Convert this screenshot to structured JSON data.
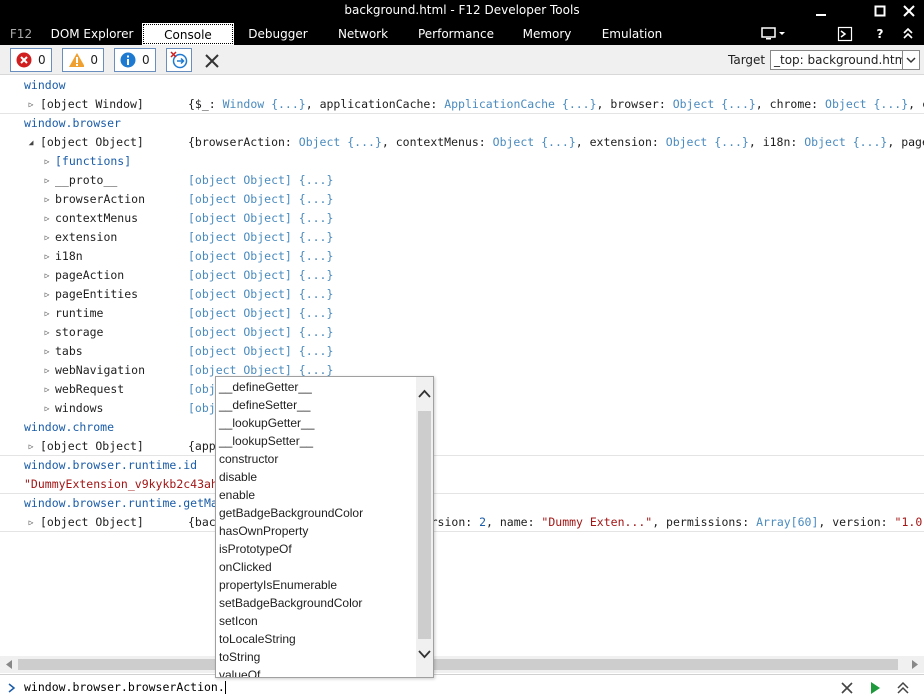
{
  "window": {
    "title": "background.html - F12 Developer Tools"
  },
  "tabs": [
    "F12",
    "DOM Explorer",
    "Console",
    "Debugger",
    "Network",
    "Performance",
    "Memory",
    "Emulation"
  ],
  "toolbar": {
    "errors_count": "0",
    "warnings_count": "0",
    "messages_count": "0",
    "target_label": "Target",
    "target_value": "_top: background.html"
  },
  "console": {
    "lines": [
      {
        "type": "cmd",
        "text": "window"
      },
      {
        "type": "obj",
        "name": "[object Window]",
        "value_html": "{$_: <span class='t'>Window {...}</span>, applicationCache: <span class='t'>ApplicationCache {...}</span>, browser: <span class='t'>Object {...}</span>, chrome: <span class='t'>Object {...}</span>, client"
      },
      {
        "type": "cmd",
        "text": "window.browser"
      },
      {
        "type": "obj",
        "name": "[object Object]",
        "expanded": true,
        "value_html": "{browserAction: <span class='t'>Object {...}</span>, contextMenus: <span class='t'>Object {...}</span>, extension: <span class='t'>Object {...}</span>, i18n: <span class='t'>Object {...}</span>, pageActio"
      }
    ],
    "children": [
      {
        "name": "[functions]",
        "value": ""
      },
      {
        "name": "__proto__",
        "value": "[object Object] {...}"
      },
      {
        "name": "browserAction",
        "value": "[object Object] {...}"
      },
      {
        "name": "contextMenus",
        "value": "[object Object] {...}"
      },
      {
        "name": "extension",
        "value": "[object Object] {...}"
      },
      {
        "name": "i18n",
        "value": "[object Object] {...}"
      },
      {
        "name": "pageAction",
        "value": "[object Object] {...}"
      },
      {
        "name": "pageEntities",
        "value": "[object Object] {...}"
      },
      {
        "name": "runtime",
        "value": "[object Object] {...}"
      },
      {
        "name": "storage",
        "value": "[object Object] {...}"
      },
      {
        "name": "tabs",
        "value": "[object Object] {...}"
      },
      {
        "name": "webNavigation",
        "value": "[object Object] {...}"
      },
      {
        "name": "webRequest",
        "value": "[obj"
      },
      {
        "name": "windows",
        "value": "[obj"
      }
    ],
    "after": [
      {
        "type": "cmd",
        "text": "window.chrome"
      },
      {
        "type": "obj",
        "name": "[object Object]",
        "value_html": "{app"
      },
      {
        "type": "cmd",
        "text": "window.browser.runtime.id"
      },
      {
        "type": "str",
        "text": "\"DummyExtension_v9kykb2c43ah8"
      },
      {
        "type": "cmd",
        "text": "window.browser.runtime.getMan"
      },
      {
        "type": "obj",
        "name": "[object Object]",
        "value_html": "{bac<span style='display:inline-block;width:208px'></span>ersion: <span class='n'>2</span>, name: <span class='str'>\"Dummy Exten...\"</span>, permissions: <span class='t'>Array[60]</span>, version: <span class='str'>\"1.0\"</span>}"
      }
    ]
  },
  "autocomplete": {
    "items": [
      "__defineGetter__",
      "__defineSetter__",
      "__lookupGetter__",
      "__lookupSetter__",
      "constructor",
      "disable",
      "enable",
      "getBadgeBackgroundColor",
      "hasOwnProperty",
      "isPrototypeOf",
      "onClicked",
      "propertyIsEnumerable",
      "setBadgeBackgroundColor",
      "setIcon",
      "toLocaleString",
      "toString",
      "valueOf"
    ]
  },
  "input": {
    "value": "window.browser.browserAction."
  }
}
